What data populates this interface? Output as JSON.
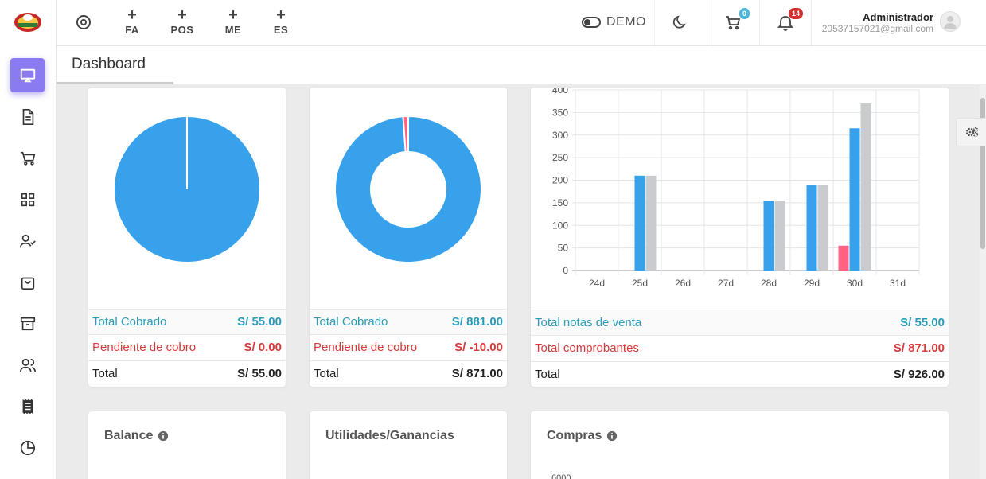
{
  "topbar": {
    "shortcuts": [
      "FA",
      "POS",
      "ME",
      "ES"
    ],
    "demo_label": "DEMO",
    "cart_count": "0",
    "notif_count": "14",
    "user_name": "Administrador",
    "user_email": "20537157021@gmail.com"
  },
  "page": {
    "title": "Dashboard"
  },
  "card1": {
    "rows": [
      {
        "label": "Total Cobrado",
        "value": "S/ 55.00"
      },
      {
        "label": "Pendiente de cobro",
        "value": "S/ 0.00"
      },
      {
        "label": "Total",
        "value": "S/ 55.00"
      }
    ]
  },
  "card2": {
    "rows": [
      {
        "label": "Total Cobrado",
        "value": "S/ 881.00"
      },
      {
        "label": "Pendiente de cobro",
        "value": "S/ -10.00"
      },
      {
        "label": "Total",
        "value": "S/ 871.00"
      }
    ]
  },
  "card3": {
    "rows": [
      {
        "label": "Total notas de venta",
        "value": "S/ 55.00"
      },
      {
        "label": "Total comprobantes",
        "value": "S/ 871.00"
      },
      {
        "label": "Total",
        "value": "S/ 926.00"
      }
    ]
  },
  "bottom": {
    "balance": "Balance",
    "utilidades": "Utilidades/Ganancias",
    "compras": "Compras",
    "compras_tick": "6000"
  },
  "colors": {
    "accent": "#8b7bf0",
    "blue": "#37a2eb",
    "grey": "#c9cbcf",
    "pink": "#ff6384"
  },
  "chart_data": [
    {
      "type": "pie",
      "slices": [
        {
          "label": "Total Cobrado",
          "value": 55.0
        },
        {
          "label": "Pendiente de cobro",
          "value": 0.0
        }
      ]
    },
    {
      "type": "pie",
      "donut": true,
      "slices": [
        {
          "label": "Total Cobrado",
          "value": 881.0
        },
        {
          "label": "Pendiente de cobro",
          "value": 10.0
        }
      ]
    },
    {
      "type": "bar",
      "categories": [
        "24d",
        "25d",
        "26d",
        "27d",
        "28d",
        "29d",
        "30d",
        "31d"
      ],
      "ylim": [
        0,
        400
      ],
      "yticks": [
        0,
        50,
        100,
        150,
        200,
        250,
        300,
        350,
        400
      ],
      "series": [
        {
          "color": "#ff6384",
          "values": [
            0,
            0,
            0,
            0,
            0,
            0,
            55,
            0
          ]
        },
        {
          "color": "#37a2eb",
          "values": [
            0,
            210,
            0,
            0,
            155,
            190,
            315,
            0
          ]
        },
        {
          "color": "#c9cbcf",
          "values": [
            0,
            210,
            0,
            0,
            155,
            190,
            370,
            0
          ]
        }
      ]
    }
  ]
}
